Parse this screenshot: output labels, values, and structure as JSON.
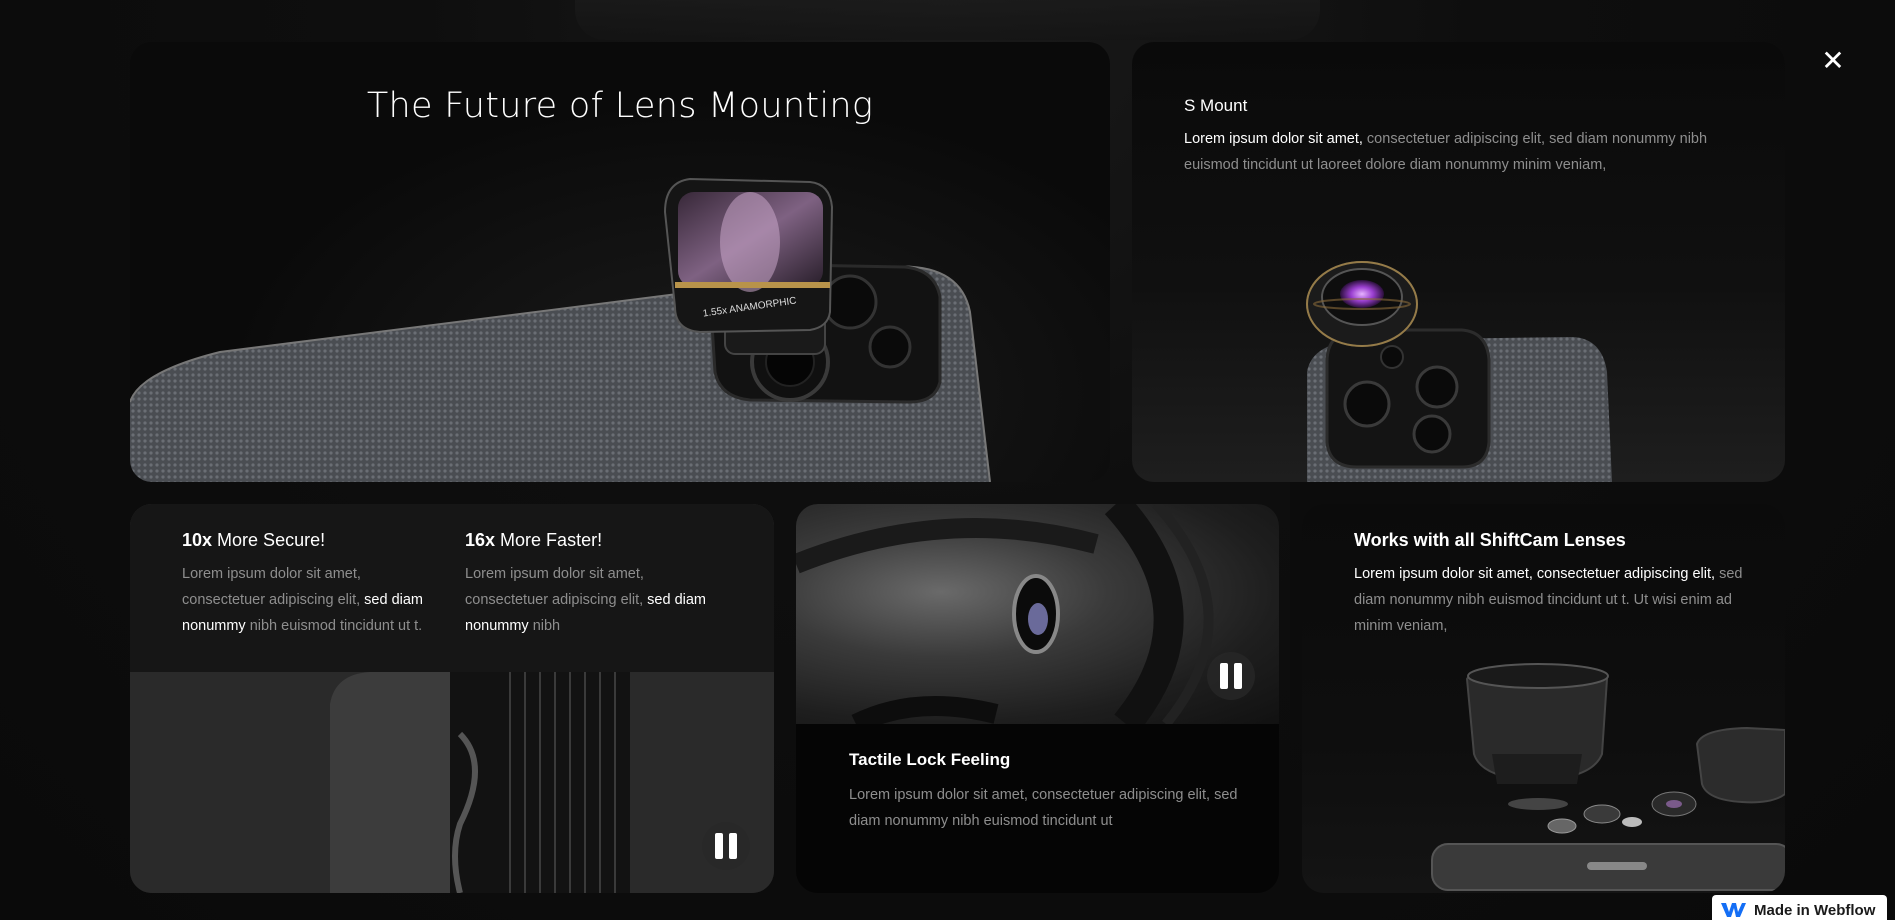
{
  "hero": {
    "title": "The Future of Lens Mounting",
    "lens_engraving": "1.55x ANAMORPHIC"
  },
  "s_mount": {
    "title": "S Mount",
    "text_highlight": "Lorem ipsum dolor sit amet,",
    "text_rest": " consectetuer adipiscing elit, sed diam nonummy nibh euismod tincidunt ut laoreet dolore diam nonummy minim veniam,"
  },
  "secure": {
    "stat1": {
      "number": "10x",
      "label": " More Secure!",
      "text_a": "Lorem ipsum dolor sit amet, consectetuer adipiscing elit, ",
      "text_hl": "sed diam nonummy",
      "text_b": " nibh euismod tincidunt ut t."
    },
    "stat2": {
      "number": "16x",
      "label": " More Faster!",
      "text_a": "Lorem ipsum dolor sit amet, consectetuer adipiscing elit, ",
      "text_hl": "sed diam nonummy",
      "text_b": " nibh"
    }
  },
  "tactile": {
    "title": "Tactile Lock Feeling",
    "text": "Lorem ipsum dolor sit amet, consectetuer adipiscing elit, sed diam nonummy nibh euismod tincidunt ut"
  },
  "shiftcam": {
    "title": "Works with all ShiftCam Lenses",
    "text_highlight": "Lorem ipsum dolor sit amet, consectetuer adipiscing elit,",
    "text_rest": " sed diam nonummy nibh euismod tincidunt ut t. Ut wisi enim ad minim veniam,"
  },
  "controls": {
    "close_icon": "close-icon",
    "close_glyph": "✕",
    "pause_icon": "pause-icon"
  },
  "badge": {
    "text": "Made in Webflow",
    "icon": "webflow-logo-icon"
  },
  "colors": {
    "background": "#0d0d0d",
    "card": "#0a0a0a",
    "muted_text": "#8e8e8e",
    "accent_lens": "#b07ad8",
    "gold_ring": "#b8934a"
  }
}
